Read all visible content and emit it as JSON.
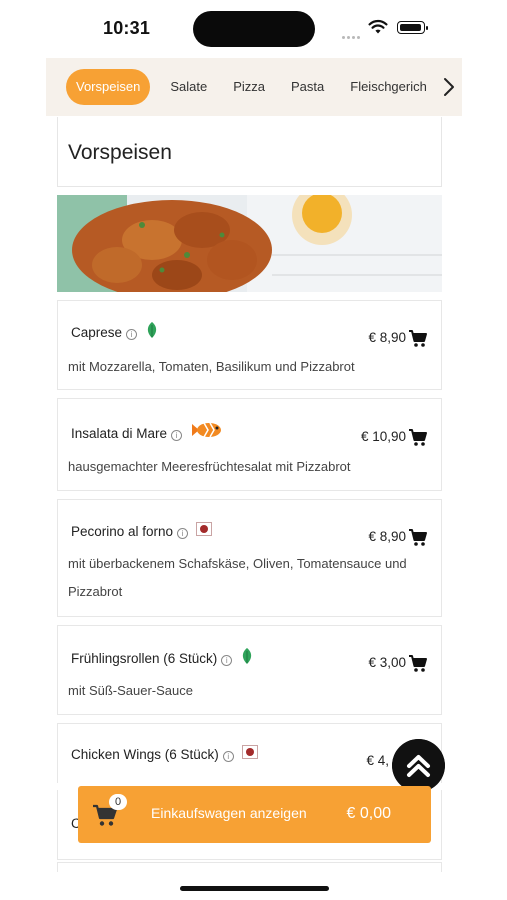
{
  "status": {
    "time": "10:31"
  },
  "categories": [
    "Vorspeisen",
    "Salate",
    "Pizza",
    "Pasta",
    "Fleischgerich"
  ],
  "section": {
    "title": "Vorspeisen"
  },
  "items": [
    {
      "name": "Caprese",
      "price": "€ 8,90",
      "desc": "mit Mozzarella, Tomaten, Basilikum und Pizzabrot",
      "tag": "leaf"
    },
    {
      "name": "Insalata di Mare",
      "price": "€ 10,90",
      "desc": "hausgemachter Meeresfrüchtesalat mit Pizzabrot",
      "tag": "fish"
    },
    {
      "name": "Pecorino al forno",
      "price": "€ 8,90",
      "desc": "mit überbackenem Schafskäse, Oliven, Tomatensauce und Pizzabrot",
      "tag": "red"
    },
    {
      "name": "Frühlingsrollen (6 Stück)",
      "price": "€ 3,00",
      "desc": "mit Süß-Sauer-Sauce",
      "tag": "leaf"
    },
    {
      "name": "Chicken Wings (6 Stück)",
      "price": "€ 4,",
      "desc": "",
      "tag": "red"
    }
  ],
  "partial_item_initial": "C",
  "info_glyph": "i",
  "cart": {
    "count": "0",
    "label": "Einkaufswagen anzeigen",
    "total": "€ 0,00"
  },
  "colors": {
    "accent": "#f7a134",
    "leaf": "#2fa35a",
    "red_tag": "#a32a2a"
  }
}
